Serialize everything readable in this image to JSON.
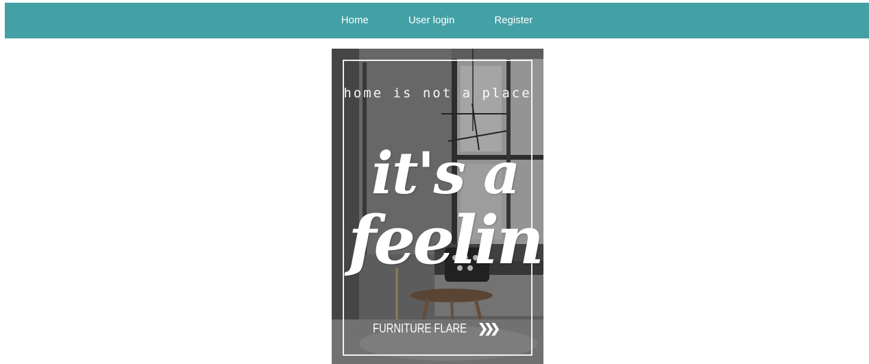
{
  "nav": {
    "items": [
      {
        "label": "Home"
      },
      {
        "label": "User login"
      },
      {
        "label": "Register"
      }
    ],
    "background": "#43a0a5",
    "text_color": "#ffffff"
  },
  "poster": {
    "tagline": "home is not a place",
    "script_line1": "it's a",
    "script_line2": "feeling",
    "brand": "FURNITURE FLARE",
    "brand_icon": "chevron-right-icon"
  }
}
